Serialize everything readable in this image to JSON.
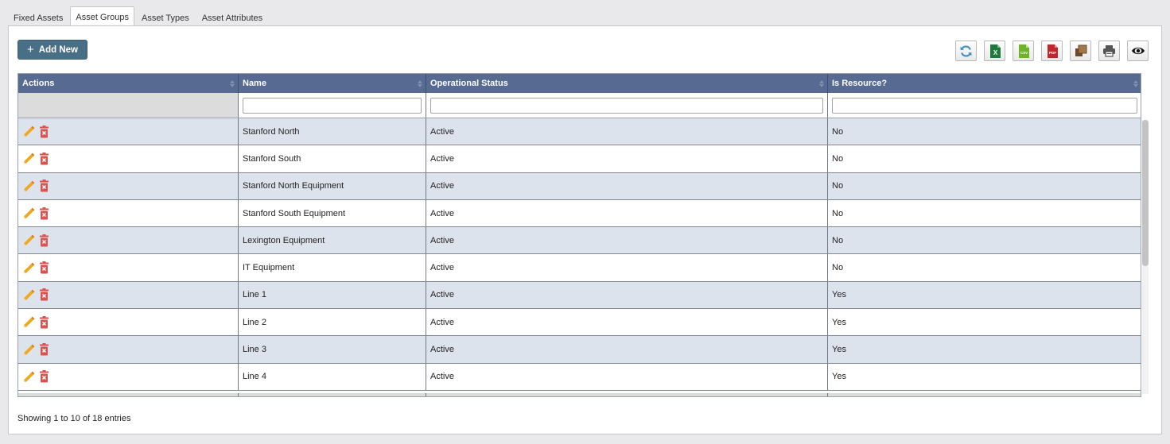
{
  "tabs": [
    {
      "label": "Fixed Assets"
    },
    {
      "label": "Asset Groups"
    },
    {
      "label": "Asset Types"
    },
    {
      "label": "Asset Attributes"
    }
  ],
  "active_tab": "Asset Groups",
  "toolbar": {
    "add_new_label": "Add New",
    "icons": [
      "refresh-icon",
      "excel-icon",
      "csv-icon",
      "pdf-icon",
      "copy-icon",
      "print-icon",
      "column-visibility-icon"
    ]
  },
  "grid": {
    "columns": [
      "Actions",
      "Name",
      "Operational Status",
      "Is Resource?"
    ],
    "filters": {
      "name": "",
      "status": "",
      "resource": ""
    },
    "rows": [
      {
        "name": "Stanford North",
        "status": "Active",
        "resource": "No"
      },
      {
        "name": "Stanford South",
        "status": "Active",
        "resource": "No"
      },
      {
        "name": "Stanford North Equipment",
        "status": "Active",
        "resource": "No"
      },
      {
        "name": "Stanford South Equipment",
        "status": "Active",
        "resource": "No"
      },
      {
        "name": "Lexington Equipment",
        "status": "Active",
        "resource": "No"
      },
      {
        "name": "IT Equipment",
        "status": "Active",
        "resource": "No"
      },
      {
        "name": "Line 1",
        "status": "Active",
        "resource": "Yes"
      },
      {
        "name": "Line 2",
        "status": "Active",
        "resource": "Yes"
      },
      {
        "name": "Line 3",
        "status": "Active",
        "resource": "Yes"
      },
      {
        "name": "Line 4",
        "status": "Active",
        "resource": "Yes"
      }
    ]
  },
  "footer": {
    "info": "Showing 1 to 10 of 18 entries"
  },
  "colors": {
    "header": "#566a92",
    "odd_row": "#dde3ec",
    "add_button": "#486f86",
    "edit_icon": "#f0a81c",
    "delete_icon": "#d9534f"
  }
}
